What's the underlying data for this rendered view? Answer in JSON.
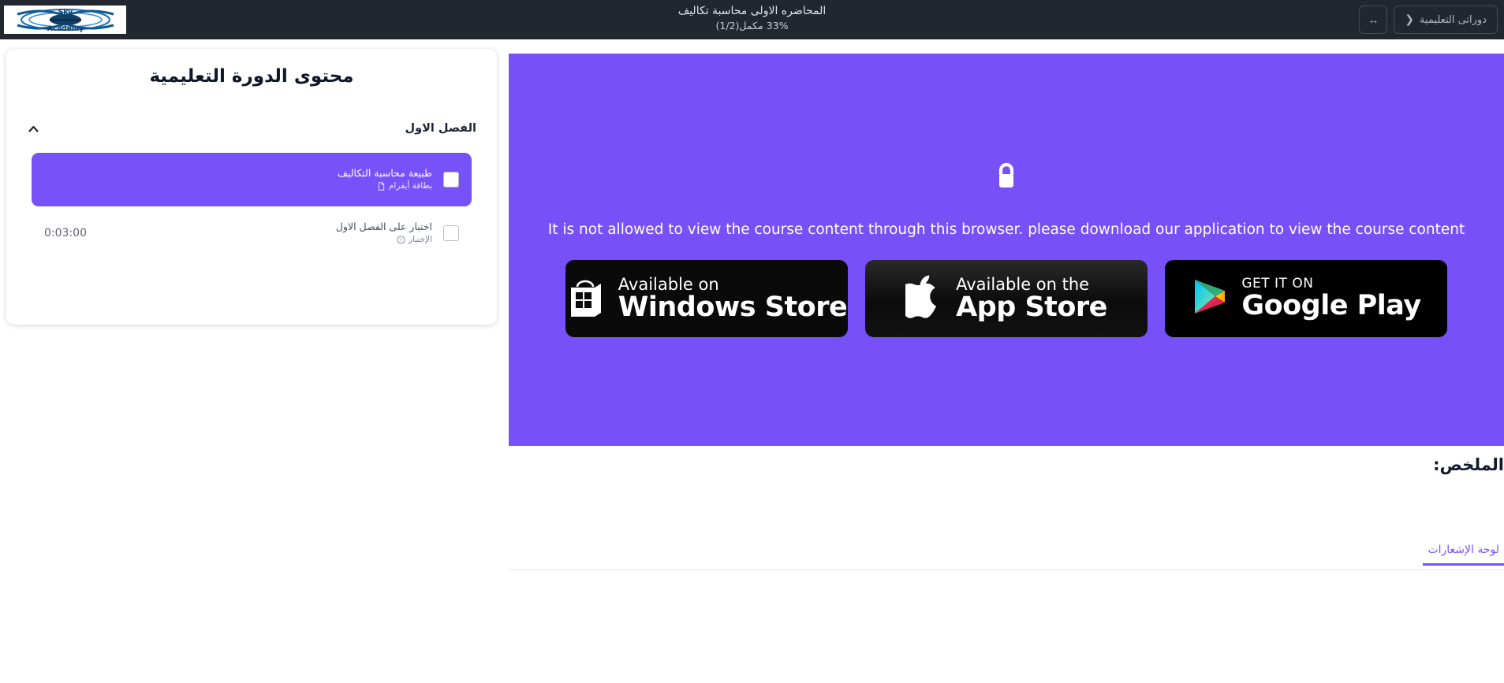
{
  "topbar": {
    "back_label": "دوراتى التعليمية",
    "back_chevron_icon": "chevron-left-icon",
    "toggle_icon": "arrows-left-right-icon",
    "title": "المحاضره الاولى محاسبة تكاليف",
    "progress_text": "33% مكمل(1/2)",
    "brand_name": "Sky",
    "brand_name2": "Academy"
  },
  "sidebar": {
    "title": "محتوى الدورة التعليمية",
    "section": {
      "name": "الفصل الاول",
      "collapse_icon": "chevron-up-icon"
    },
    "lessons": [
      {
        "name": "طبيعة محاسبة التكاليف",
        "meta": "بطاقة أيقرام",
        "meta_icon": "document-icon",
        "duration": "",
        "active": true,
        "checked": false
      },
      {
        "name": "اختبار على الفصل الاول",
        "meta": "الإختبار",
        "meta_icon": "question-circle-icon",
        "duration": "0:03:00",
        "active": false,
        "checked": false
      }
    ]
  },
  "main": {
    "lock_icon": "lock-icon",
    "denied_message": "It is not allowed to view the course content through this browser. please download our application to view the course content",
    "badges": [
      {
        "id": "windows-store",
        "small": "Available on",
        "big": "Windows Store",
        "icon": "windows-store-icon"
      },
      {
        "id": "app-store",
        "small": "Available on the",
        "big": "App Store",
        "icon": "apple-icon"
      },
      {
        "id": "google-play",
        "small": "GET IT ON",
        "big": "Google Play",
        "icon": "google-play-icon"
      }
    ]
  },
  "summary": {
    "label": "الملخص:",
    "body": ""
  },
  "tabs": [
    {
      "label": "لوحة الإشعارات",
      "active": true
    }
  ],
  "colors": {
    "accent_purple": "#7850f7",
    "topbar_bg": "#22262e",
    "page_bg": "#ffffff"
  }
}
